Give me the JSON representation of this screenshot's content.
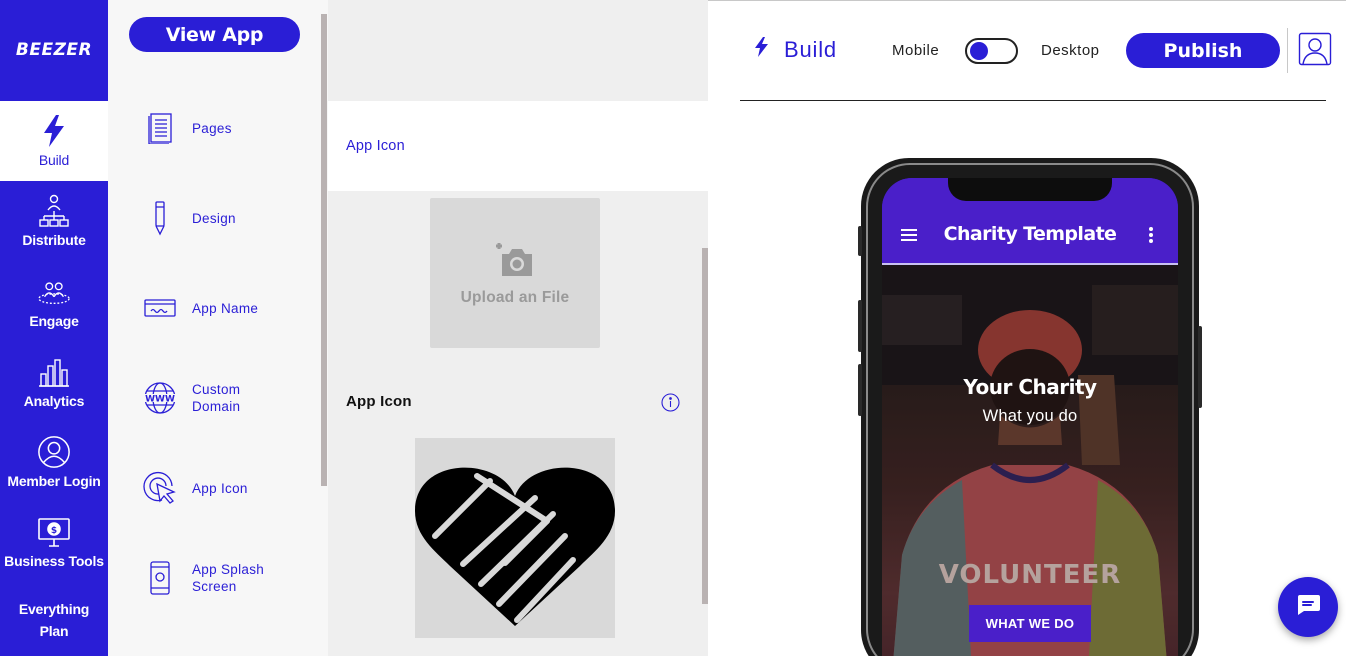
{
  "brand": {
    "logo_text": "BEEZER",
    "accent": "#2a1ed6",
    "app_purple": "#4a1fc9"
  },
  "rail": {
    "items": [
      {
        "label": "Build",
        "icon": "lightning-icon",
        "active": true
      },
      {
        "label": "Distribute",
        "icon": "distribute-icon"
      },
      {
        "label": "Engage",
        "icon": "engage-icon"
      },
      {
        "label": "Analytics",
        "icon": "analytics-icon"
      },
      {
        "label": "Member Login",
        "icon": "member-login-icon"
      },
      {
        "label": "Business Tools",
        "icon": "business-tools-icon"
      },
      {
        "label": "Everything\nPlan",
        "icon": ""
      }
    ]
  },
  "submenu": {
    "view_app_label": "View App",
    "items": [
      {
        "label": "Pages",
        "icon": "pages-icon"
      },
      {
        "label": "Design",
        "icon": "pencil-icon"
      },
      {
        "label": "App Name",
        "icon": "app-name-icon"
      },
      {
        "label": "Custom\nDomain",
        "icon": "www-globe-icon"
      },
      {
        "label": "App Icon",
        "icon": "cursor-click-icon"
      },
      {
        "label": "App Splash\nScreen",
        "icon": "phone-splash-icon"
      }
    ]
  },
  "panel": {
    "header": "App Icon",
    "upload_label": "Upload an File",
    "section_title": "App Icon"
  },
  "topbar": {
    "build_label": "Build",
    "mode_mobile": "Mobile",
    "mode_desktop": "Desktop",
    "publish_label": "Publish"
  },
  "preview": {
    "app_title": "Charity Template",
    "hero_title": "Your Charity",
    "hero_subtitle": "What you do",
    "shirt_text": "VOLUNTEER",
    "cta_label": "WHAT WE DO"
  }
}
